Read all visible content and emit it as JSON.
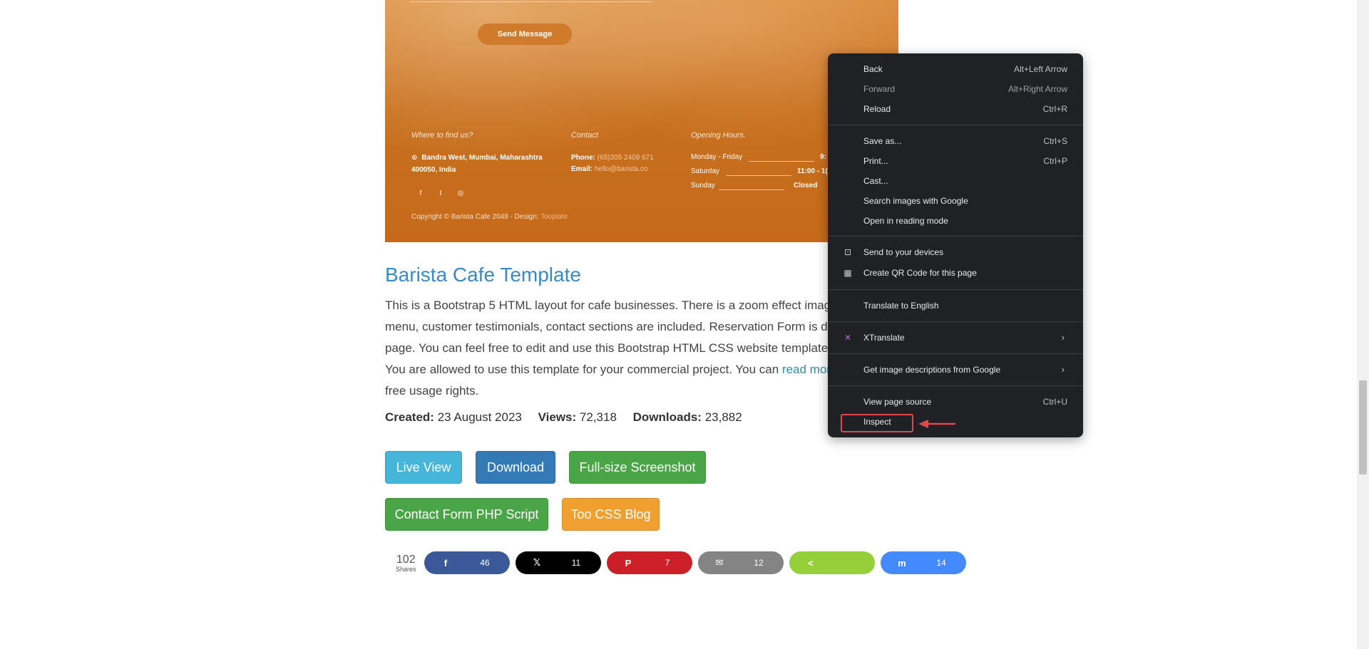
{
  "preview": {
    "send_button": "Send Message",
    "find_heading": "Where to find us?",
    "address_line1": "Bandra West, Mumbai, Maharashtra",
    "address_line2": "400050, India",
    "contact_heading": "Contact",
    "phone_label": "Phone:",
    "phone_value": "(65)305 2409 671",
    "email_label": "Email:",
    "email_value": "hello@barista.co",
    "hours_heading": "Opening Hours.",
    "hours": [
      {
        "day": "Monday - Friday",
        "time": "9:"
      },
      {
        "day": "Saturday",
        "time": "11:00 - 1("
      },
      {
        "day": "Sunday",
        "time": "Closed"
      }
    ],
    "copyright": "Copyright © Barista Cafe 2048 - Design:",
    "copyright_link": "Tooplate"
  },
  "article": {
    "title": "Barista Cafe Template",
    "lines": [
      "This is a Bootstrap 5 HTML layout for cafe businesses. There is a zoom effect image sli",
      "menu, customer testimonials, contact sections are included. Reservation Form is desig",
      "page. You can feel free to edit and use this Bootstrap HTML CSS website template for",
      "You are allowed to use this template for your commercial project. You can ",
      "free usage rights."
    ],
    "read_more": "read more a",
    "created_label": "Created:",
    "created_value": "23 August 2023",
    "views_label": "Views:",
    "views_value": "72,318",
    "downloads_label": "Downloads:",
    "downloads_value": "23,882",
    "buttons": {
      "live_view": "Live View",
      "download": "Download",
      "screenshot": "Full-size Screenshot",
      "contact_form": "Contact Form PHP Script",
      "css_blog": "Too CSS Blog"
    }
  },
  "share": {
    "total": "102",
    "total_label": "Shares",
    "items": [
      {
        "icon": "f",
        "count": "46",
        "color": "#3b5998"
      },
      {
        "icon": "𝕏",
        "count": "11",
        "color": "#000000"
      },
      {
        "icon": "P",
        "count": "7",
        "color": "#cb2027"
      },
      {
        "icon": "✉",
        "count": "12",
        "color": "#848484"
      },
      {
        "icon": "<",
        "count": "",
        "color": "#95d03a"
      },
      {
        "icon": "m",
        "count": "14",
        "color": "#448aff"
      }
    ]
  },
  "menu": {
    "back": "Back",
    "back_sc": "Alt+Left Arrow",
    "forward": "Forward",
    "forward_sc": "Alt+Right Arrow",
    "reload": "Reload",
    "reload_sc": "Ctrl+R",
    "save_as": "Save as...",
    "save_as_sc": "Ctrl+S",
    "print": "Print...",
    "print_sc": "Ctrl+P",
    "cast": "Cast...",
    "search_images": "Search images with Google",
    "reading_mode": "Open in reading mode",
    "send_devices": "Send to your devices",
    "qr_code": "Create QR Code for this page",
    "translate": "Translate to English",
    "xtranslate": "XTranslate",
    "image_desc": "Get image descriptions from Google",
    "view_source": "View page source",
    "view_source_sc": "Ctrl+U",
    "inspect": "Inspect"
  }
}
